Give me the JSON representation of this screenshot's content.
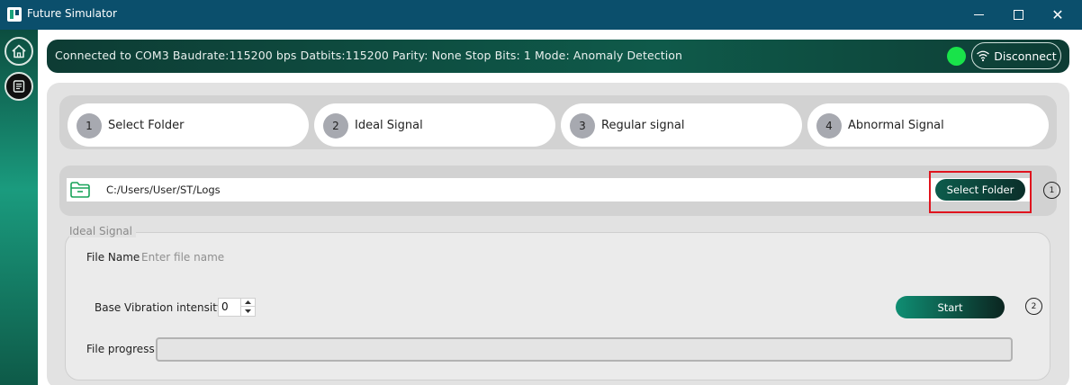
{
  "window": {
    "title": "Future Simulator",
    "close_glyph": "✕"
  },
  "status": {
    "text": "Connected to COM3   Baudrate:115200 bps Datbits:115200  Parity: None   Stop Bits: 1   Mode: Anomaly Detection",
    "indicator_color": "#19e34a",
    "disconnect_label": "Disconnect"
  },
  "steps": [
    {
      "number": "1",
      "label": "Select Folder"
    },
    {
      "number": "2",
      "label": "Ideal Signal"
    },
    {
      "number": "3",
      "label": "Regular signal"
    },
    {
      "number": "4",
      "label": "Abnormal Signal"
    }
  ],
  "folder": {
    "path": "C:/Users/User/ST/Logs",
    "button_label": "Select Folder",
    "marker": "1"
  },
  "ideal_signal": {
    "section_title": "Ideal Signal",
    "file_name_label": "File Name",
    "file_name_placeholder": "Enter file name",
    "file_name_value": "",
    "vibration_label": "Base Vibration intensity",
    "vibration_value": "0",
    "start_label": "Start",
    "marker": "2",
    "progress_label": "File progress",
    "progress_value": 0
  },
  "colors": {
    "titlebar": "#0b4f6c",
    "accent": "#0f5a4a",
    "highlight": "#e0141e"
  },
  "icons": {
    "home": "home-icon",
    "document": "document-icon",
    "wifi": "wifi-icon",
    "folder": "folder-icon"
  }
}
